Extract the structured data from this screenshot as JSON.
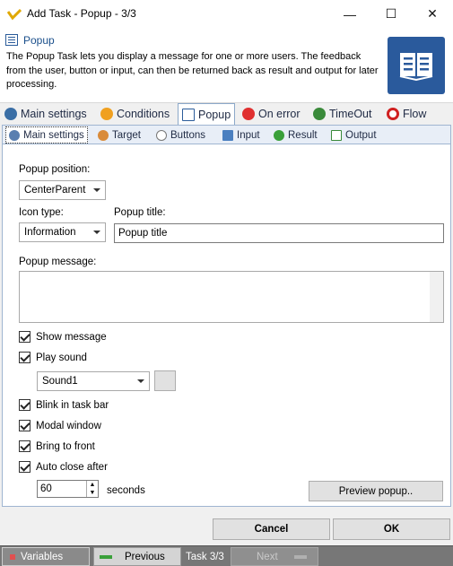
{
  "window": {
    "title": "Add Task - Popup - 3/3",
    "minimize": "—",
    "maximize": "☐",
    "close": "✕"
  },
  "header": {
    "title": "Popup",
    "description": "The Popup Task lets you display a message for one or more users. The feedback from the user, button or input, can then be returned back as result and output for later processing."
  },
  "tabs": [
    {
      "label": "Main settings",
      "icon": "gear-icon",
      "color": "#3a6ea5"
    },
    {
      "label": "Conditions",
      "icon": "question-icon",
      "color": "#f0a020"
    },
    {
      "label": "Popup",
      "icon": "window-icon",
      "color": "#2b5c9a"
    },
    {
      "label": "On error",
      "icon": "error-icon",
      "color": "#e03030"
    },
    {
      "label": "TimeOut",
      "icon": "clock-icon",
      "color": "#3a8a3a"
    },
    {
      "label": "Flow",
      "icon": "flow-icon",
      "color": "#d02020"
    }
  ],
  "subtabs": [
    {
      "label": "Main settings",
      "icon": "gear-icon"
    },
    {
      "label": "Target",
      "icon": "users-icon"
    },
    {
      "label": "Buttons",
      "icon": "mouse-icon"
    },
    {
      "label": "Input",
      "icon": "input-icon"
    },
    {
      "label": "Result",
      "icon": "check-icon"
    },
    {
      "label": "Output",
      "icon": "output-icon"
    }
  ],
  "form": {
    "position_label": "Popup position:",
    "position_value": "CenterParent",
    "icon_label": "Icon type:",
    "icon_value": "Information",
    "title_label": "Popup title:",
    "title_value": "Popup title",
    "message_label": "Popup message:",
    "message_value": "",
    "show_message": "Show message",
    "play_sound": "Play sound",
    "sound_value": "Sound1",
    "blink": "Blink in task bar",
    "modal": "Modal window",
    "bring_front": "Bring to front",
    "auto_close": "Auto close after",
    "seconds_value": "60",
    "seconds_label": "seconds",
    "preview": "Preview popup.."
  },
  "buttons": {
    "cancel": "Cancel",
    "ok": "OK"
  },
  "footer": {
    "variables": "Variables",
    "previous": "Previous",
    "task": "Task 3/3",
    "next": "Next"
  }
}
